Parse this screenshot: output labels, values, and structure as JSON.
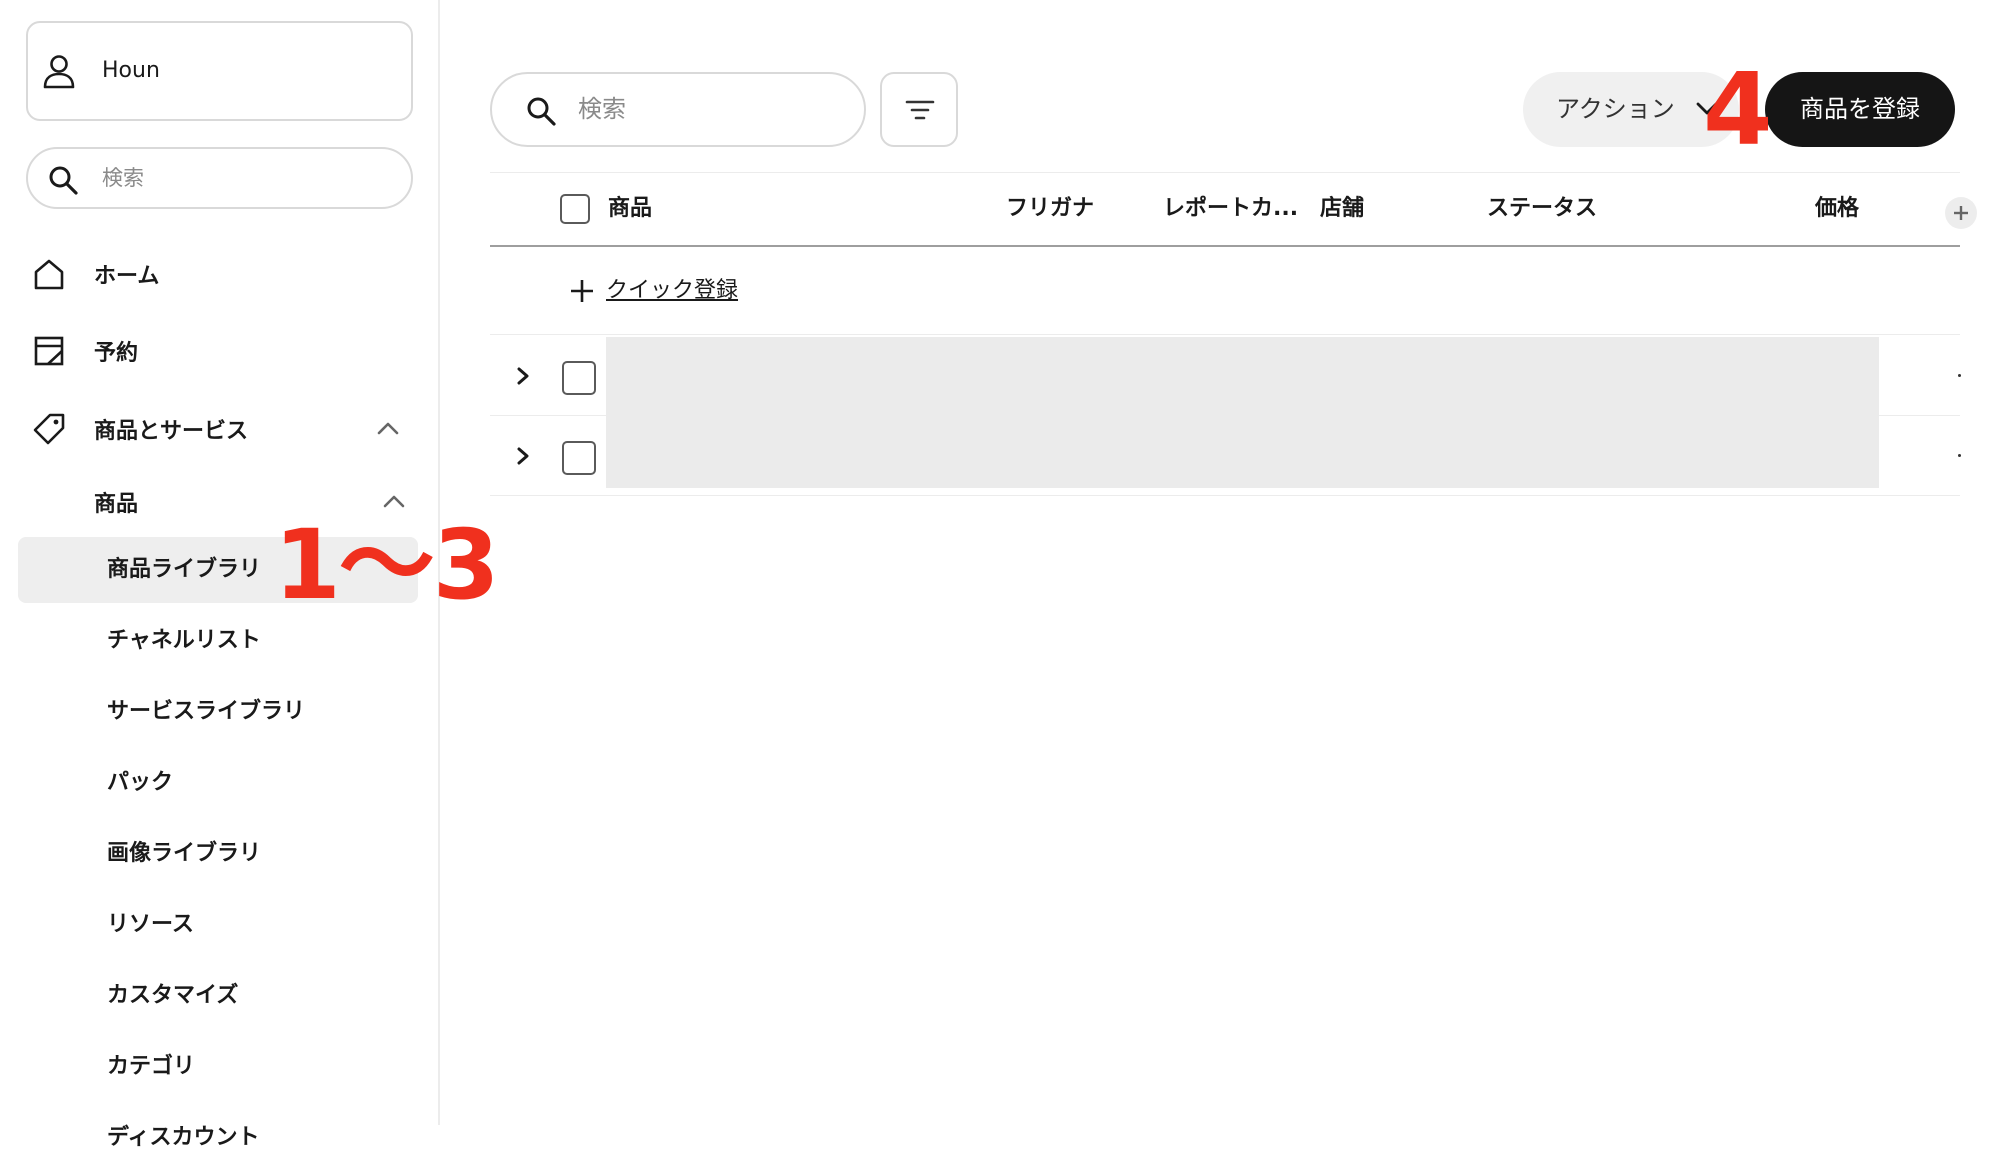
{
  "sidebar": {
    "account_name": "Houn",
    "search_placeholder": "検索",
    "nav": [
      {
        "label": "ホーム",
        "icon": "home-icon"
      },
      {
        "label": "予約",
        "icon": "calendar-icon"
      },
      {
        "label": "商品とサービス",
        "icon": "tag-icon",
        "expanded": true
      }
    ],
    "section": {
      "label": "商品",
      "expanded": true
    },
    "sub_items": [
      {
        "label": "商品ライブラリ",
        "active": true
      },
      {
        "label": "チャネルリスト"
      },
      {
        "label": "サービスライブラリ"
      },
      {
        "label": "パック"
      },
      {
        "label": "画像ライブラリ"
      },
      {
        "label": "リソース"
      },
      {
        "label": "カスタマイズ"
      },
      {
        "label": "カテゴリ"
      },
      {
        "label": "ディスカウント"
      }
    ]
  },
  "toolbar": {
    "search_placeholder": "検索",
    "action_label": "アクション",
    "primary_label": "商品を登録"
  },
  "table": {
    "columns": [
      "商品",
      "フリガナ",
      "レポートカ...",
      "店舗",
      "ステータス",
      "価格"
    ],
    "quick_add_label": "クイック登録",
    "row_count": 2
  },
  "annotations": {
    "steps_1_3": "1〜3",
    "step_4": "4",
    "color": "#f0301e"
  }
}
